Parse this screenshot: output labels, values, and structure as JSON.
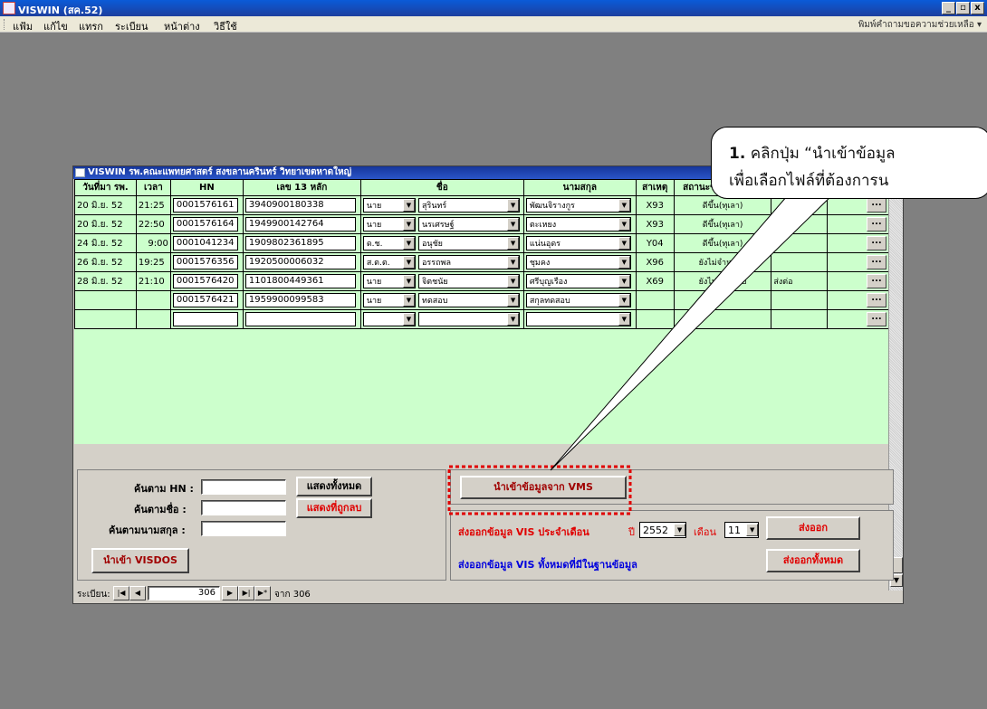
{
  "window": {
    "title": "VISWIN (สค.52)",
    "btn_min": "_",
    "btn_max": "▫",
    "btn_close": "x"
  },
  "menu": {
    "items": [
      "แฟ้ม",
      "แก้ไข",
      "แทรก",
      "ระเบียน",
      "หน้าต่าง",
      "วิธีใช้"
    ],
    "help_placeholder": "พิมพ์คำถามขอความช่วยเหลือ"
  },
  "form": {
    "title": "VISWIN รพ.คณะแพทยศาสตร์ สงขลานครินทร์ วิทยาเขตหาดใหญ่",
    "columns": [
      "วันที่มา รพ.",
      "เวลา",
      "HN",
      "เลข 13 หลัก",
      "ชื่อ",
      "นามสกุล",
      "สาเหตุ",
      "สถานะขณะจำหน่าย",
      "",
      ""
    ],
    "rows": [
      {
        "date": "20 มิ.ย. 52",
        "time": "21:25",
        "hn": "0001576161",
        "id13": "3940900180338",
        "prefix": "นาย",
        "first": "สุรินทร์",
        "last": "พัฒนจิรางกูร",
        "cause": "X93",
        "status": "ดีขึ้น(ทุเลา)",
        "extra": ""
      },
      {
        "date": "20 มิ.ย. 52",
        "time": "22:50",
        "hn": "0001576164",
        "id13": "1949900142764",
        "prefix": "นาย",
        "first": "นรเศรษฐ์",
        "last": "ตะเหยง",
        "cause": "X93",
        "status": "ดีขึ้น(ทุเลา)",
        "extra": ""
      },
      {
        "date": "24 มิ.ย. 52",
        "time": "9:00",
        "hn": "0001041234",
        "id13": "1909802361895",
        "prefix": "ด.ช.",
        "first": "อนุชัย",
        "last": "แน่นอุดร",
        "cause": "Y04",
        "status": "ดีขึ้น(ทุเลา)",
        "extra": ""
      },
      {
        "date": "26 มิ.ย. 52",
        "time": "19:25",
        "hn": "0001576356",
        "id13": "1920500006032",
        "prefix": "ส.ต.ต.",
        "first": "อรรถพล",
        "last": "ชุมคง",
        "cause": "X96",
        "status": "ยังไม่จำหน่าย",
        "extra": ""
      },
      {
        "date": "28 มิ.ย. 52",
        "time": "21:10",
        "hn": "0001576420",
        "id13": "1101800449361",
        "prefix": "นาย",
        "first": "จิตชนัย",
        "last": "ศรีบุญเรือง",
        "cause": "X69",
        "status": "ยังไม่จำหน่าย",
        "extra": "ส่งต่อ"
      },
      {
        "date": "",
        "time": "",
        "hn": "0001576421",
        "id13": "1959900099583",
        "prefix": "นาย",
        "first": "ทดสอบ",
        "last": "สกุลทดสอบ",
        "cause": "",
        "status": "",
        "extra": ""
      },
      {
        "date": "",
        "time": "",
        "hn": "",
        "id13": "",
        "prefix": "",
        "first": "",
        "last": "",
        "cause": "",
        "status": "",
        "extra": ""
      }
    ],
    "dots_label": "...",
    "search": {
      "hn_label": "ค้นตาม HN :",
      "name_label": "ค้นตามชื่อ :",
      "surname_label": "ค้นตามนามสกุล :",
      "show_all": "แสดงทั้งหมด",
      "show_deleted": "แสดงที่ถูกลบ",
      "import_visdos": "นำเข้า VISDOS"
    },
    "import_vms": "นำเข้าข้อมูลจาก VMS",
    "export": {
      "monthly_label": "ส่งออกข้อมูล VIS ประจำเดือน",
      "year_label": "ปี",
      "year": "2552",
      "month_label": "เดือน",
      "month": "11",
      "export_btn": "ส่งออก",
      "all_label": "ส่งออกข้อมูล VIS ทั้งหมดที่มีในฐานข้อมูล",
      "export_all_btn": "ส่งออกทั้งหมด"
    },
    "nav": {
      "label": "ระเบียน:",
      "current": "306",
      "of": "จาก 306"
    }
  },
  "callout": {
    "number": "1.",
    "line1": "คลิกปุ่ม “นำเข้าข้อมูล",
    "line2": "เพื่อเลือกไฟล์ที่ต้องการน"
  }
}
